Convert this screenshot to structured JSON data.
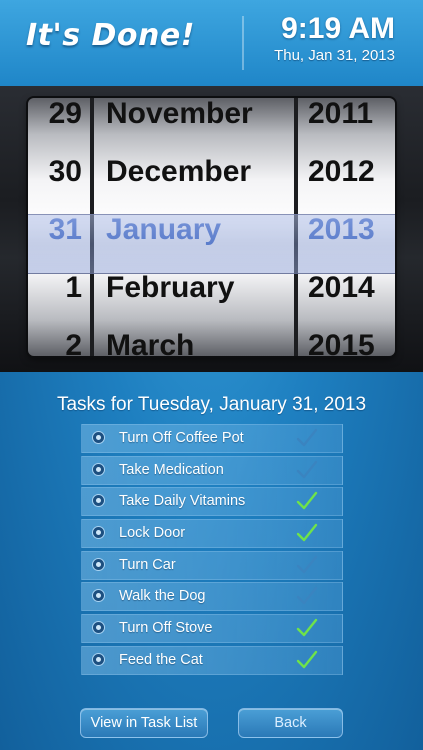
{
  "header": {
    "logo_text": "It's Done!",
    "time": "9:19 AM",
    "date": "Thu, Jan 31, 2013"
  },
  "picker": {
    "days": [
      "29",
      "30",
      "31",
      "1",
      "2"
    ],
    "months": [
      "November",
      "December",
      "January",
      "February",
      "March"
    ],
    "years": [
      "2011",
      "2012",
      "2013",
      "2014",
      "2015"
    ],
    "selected": {
      "day": "31",
      "month": "January",
      "year": "2013"
    },
    "selected_color": "#3b67c9"
  },
  "tasks": {
    "title": "Tasks for Tuesday, January 31, 2013",
    "items": [
      {
        "label": "Turn Off Coffee Pot",
        "icon": "clock-icon",
        "done": false
      },
      {
        "label": "Take Medication",
        "icon": "target-icon",
        "done": false
      },
      {
        "label": "Take Daily Vitamins",
        "icon": "refresh-icon",
        "done": true
      },
      {
        "label": "Lock Door",
        "icon": "clock-icon",
        "done": true
      },
      {
        "label": "Turn Car",
        "icon": "clock-icon",
        "done": false
      },
      {
        "label": "Walk the Dog",
        "icon": "target-icon",
        "done": false
      },
      {
        "label": "Turn Off Stove",
        "icon": "refresh-icon",
        "done": true
      },
      {
        "label": "Feed the Cat",
        "icon": "clock-icon",
        "done": true
      }
    ],
    "check_done_color": "#6fe34a",
    "check_pending_color": "#3a84c0"
  },
  "buttons": {
    "view_label": "View in Task List",
    "back_label": "Back"
  }
}
